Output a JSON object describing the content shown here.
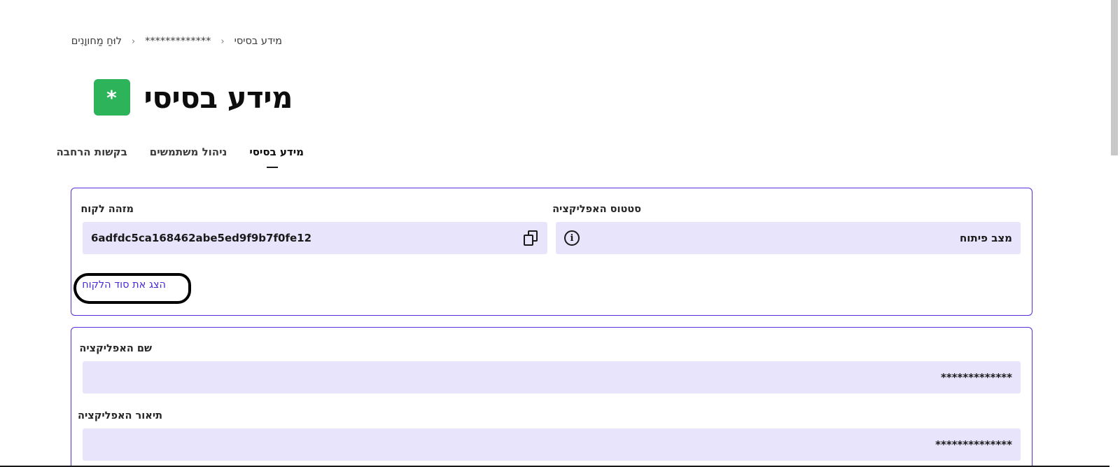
{
  "breadcrumb": {
    "items": [
      "מידע בסיסי",
      "*************",
      "לוּחַ מַחווָנִים"
    ],
    "separator": "‹"
  },
  "header": {
    "badge_symbol": "*",
    "title": "מידע בסיסי",
    "badge_color": "#2db359"
  },
  "tabs": [
    {
      "label": "מידע בסיסי",
      "active": true
    },
    {
      "label": "ניהול משתמשים",
      "active": false
    },
    {
      "label": "בקשות הרחבה",
      "active": false
    }
  ],
  "credentials": {
    "status_label": "סטטוס האפליקציה",
    "status_value": "מצב פיתוח",
    "status_icon": "info-icon",
    "client_id_label": "מזהה לקוח",
    "client_id_value": "6adfdc5ca168462abe5ed9f9b7f0fe12",
    "copy_icon": "copy-icon",
    "show_secret_link": "הצג את סוד הלקוח"
  },
  "app_details": {
    "name_label": "שם האפליקציה",
    "name_value": "*************",
    "description_label": "תיאור האפליקציה",
    "description_value": "**************"
  },
  "colors": {
    "accent": "#5a2de0",
    "field_background": "#e8e4fc",
    "link": "#4b28d6"
  }
}
